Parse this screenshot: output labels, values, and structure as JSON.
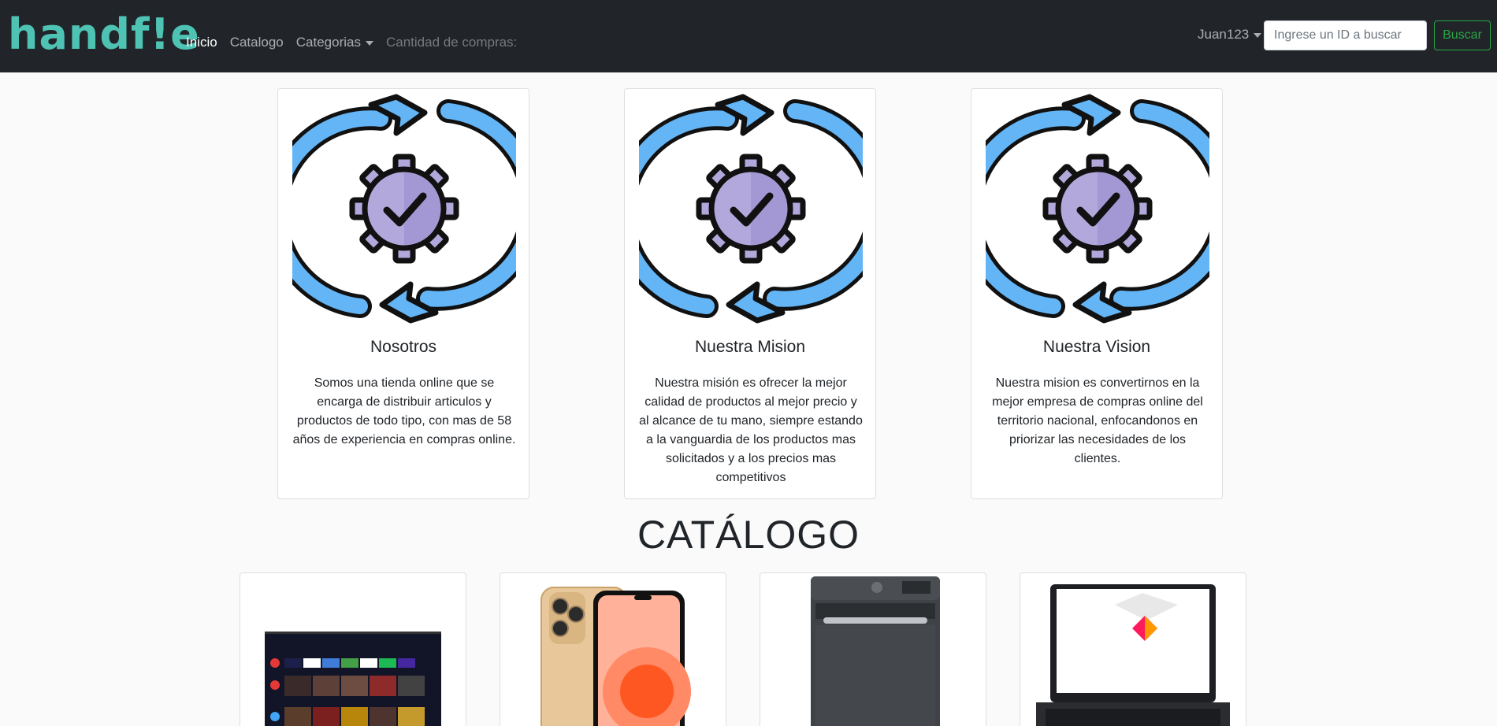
{
  "navbar": {
    "brand": "handf!e",
    "links": [
      {
        "label": "Inicio",
        "active": true
      },
      {
        "label": "Catalogo",
        "active": false
      },
      {
        "label": "Categorias",
        "active": false
      }
    ],
    "purchases_label": "Cantidad de compras:",
    "user": "Juan123",
    "search_placeholder": "Ingrese un ID a buscar",
    "search_button": "Buscar"
  },
  "info_cards": [
    {
      "title": "Nosotros",
      "text": "Somos una tienda online que se encarga de distribuir articulos y productos de todo tipo, con mas de 58 años de experiencia en compras online.",
      "icon": "sync-gear-check-icon"
    },
    {
      "title": "Nuestra Mision",
      "text": "Nuestra misión es ofrecer la mejor calidad de productos al mejor precio y al alcance de tu mano, siempre estando a la vanguardia de los productos mas solicitados y a los precios mas competitivos",
      "icon": "sync-gear-check-icon"
    },
    {
      "title": "Nuestra Vision",
      "text": "Nuestra mision es convertirnos en la mejor empresa de compras online del territorio nacional, enfocandonos en priorizar las necesidades de los clientes.",
      "icon": "sync-gear-check-icon"
    }
  ],
  "catalog": {
    "title": "CATÁLOGO",
    "products": [
      {
        "image": "smart-tv-image"
      },
      {
        "image": "smartphone-image"
      },
      {
        "image": "washing-machine-image"
      },
      {
        "image": "laptop-image"
      }
    ]
  },
  "colors": {
    "navbar_bg": "#212529",
    "brand": "#4ec3b4",
    "success": "#28a745",
    "arrow_blue": "#64b5f6",
    "gear_purple": "#b3a8dc"
  }
}
